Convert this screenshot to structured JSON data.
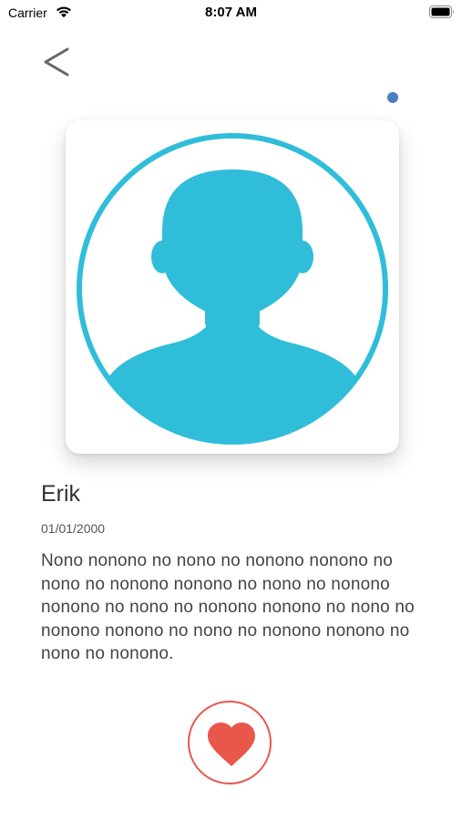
{
  "status_bar": {
    "carrier": "Carrier",
    "time": "8:07 AM",
    "wifi_icon": "wifi-icon",
    "battery_icon": "battery-icon"
  },
  "nav": {
    "back_icon": "chevron-left-icon",
    "indicator_color": "#4a7fc1"
  },
  "profile": {
    "avatar_icon": "person-avatar-icon",
    "avatar_color": "#30bdd9",
    "name": "Erik",
    "date_of_birth": "01/01/2000",
    "bio": "Nono nonono no nono no nonono nonono no nono no nonono nonono no nono no nonono nonono no nono no nonono nonono no nono no nonono nonono no nono no nonono nonono no nono no nonono."
  },
  "actions": {
    "like_icon": "heart-icon",
    "like_color": "#e8574a"
  }
}
